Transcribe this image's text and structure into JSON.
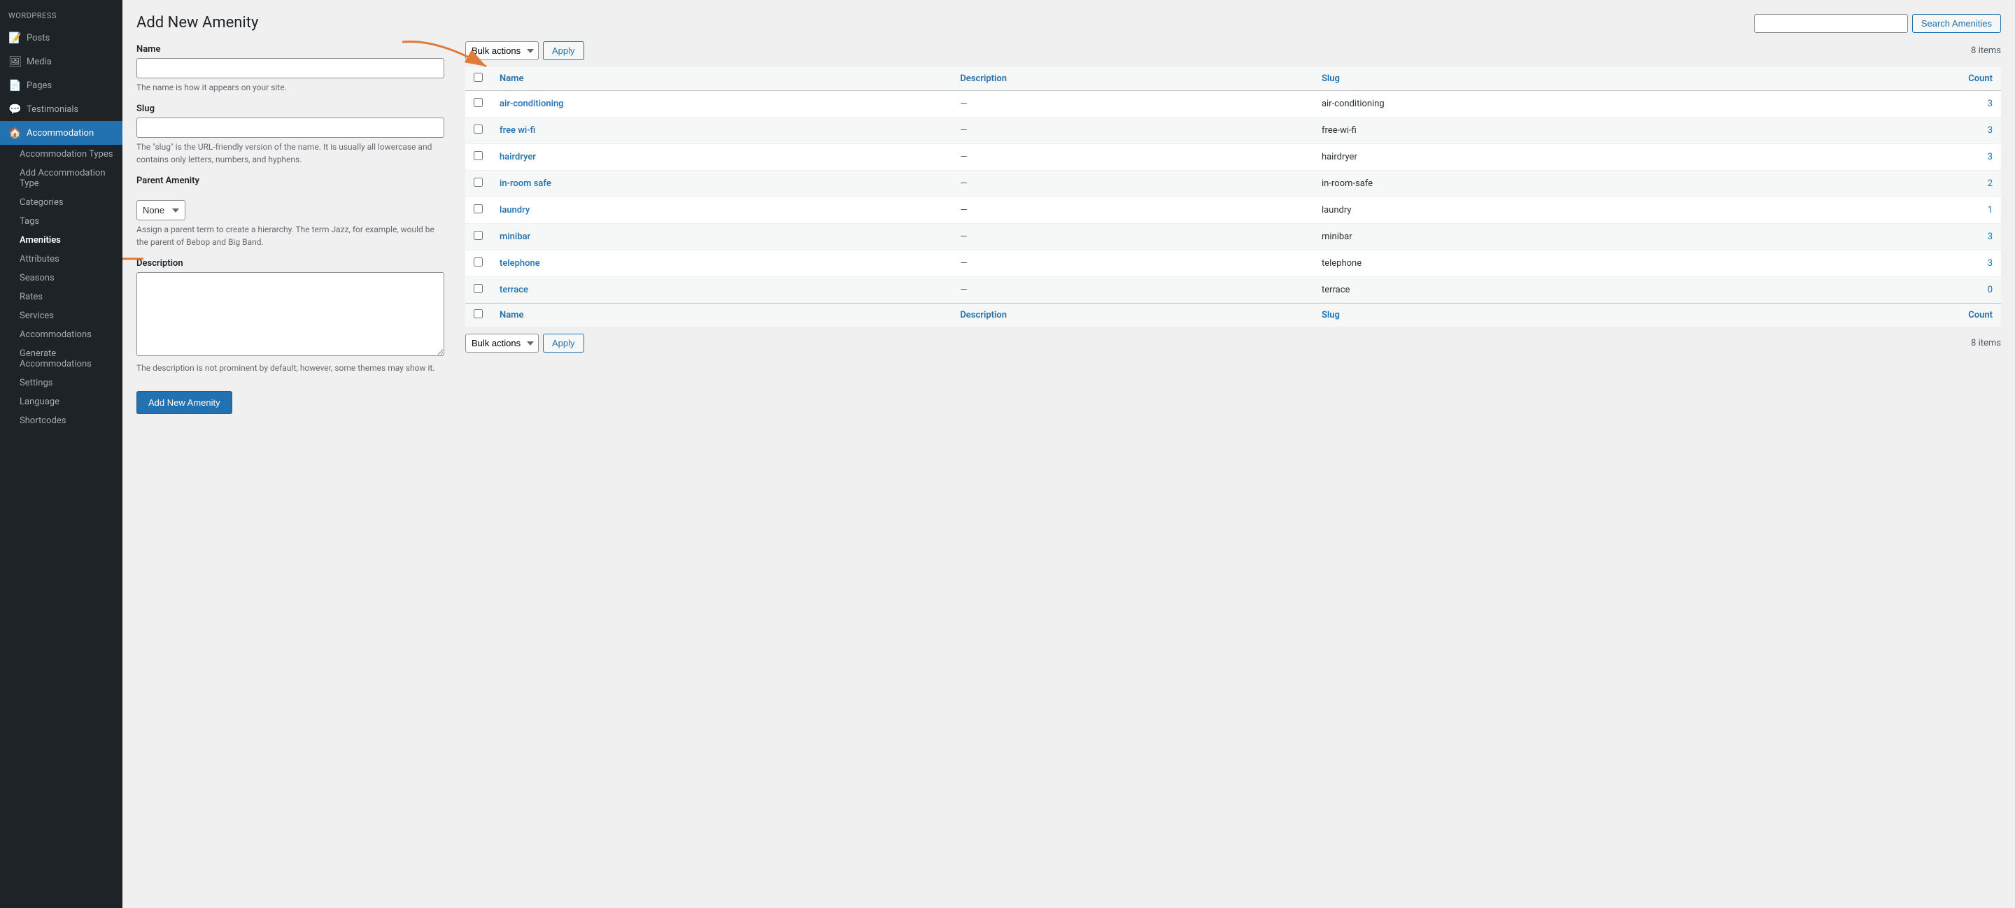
{
  "sidebar": {
    "items": [
      {
        "id": "posts",
        "label": "Posts",
        "icon": "📝"
      },
      {
        "id": "media",
        "label": "Media",
        "icon": "🖼"
      },
      {
        "id": "pages",
        "label": "Pages",
        "icon": "📄"
      },
      {
        "id": "testimonials",
        "label": "Testimonials",
        "icon": "💬"
      },
      {
        "id": "accommodation",
        "label": "Accommodation",
        "icon": "🏠",
        "active": true
      }
    ],
    "submenu": [
      {
        "id": "accommodation-types",
        "label": "Accommodation Types"
      },
      {
        "id": "add-accommodation-type",
        "label": "Add Accommodation Type"
      },
      {
        "id": "categories",
        "label": "Categories"
      },
      {
        "id": "tags",
        "label": "Tags"
      },
      {
        "id": "amenities",
        "label": "Amenities",
        "active": true
      },
      {
        "id": "attributes",
        "label": "Attributes"
      },
      {
        "id": "seasons",
        "label": "Seasons"
      },
      {
        "id": "rates",
        "label": "Rates"
      },
      {
        "id": "services",
        "label": "Services"
      },
      {
        "id": "accommodations",
        "label": "Accommodations"
      },
      {
        "id": "generate-accommodations",
        "label": "Generate Accommodations"
      },
      {
        "id": "settings",
        "label": "Settings"
      },
      {
        "id": "language",
        "label": "Language"
      },
      {
        "id": "shortcodes",
        "label": "Shortcodes"
      }
    ]
  },
  "form": {
    "title": "Add New Amenity",
    "name_label": "Name",
    "name_placeholder": "",
    "name_hint": "The name is how it appears on your site.",
    "slug_label": "Slug",
    "slug_placeholder": "",
    "slug_hint": "The \"slug\" is the URL-friendly version of the name. It is usually all lowercase and contains only letters, numbers, and hyphens.",
    "parent_label": "Parent Amenity",
    "parent_default": "None",
    "parent_hint": "Assign a parent term to create a hierarchy. The term Jazz, for example, would be the parent of Bebop and Big Band.",
    "description_label": "Description",
    "description_hint": "The description is not prominent by default; however, some themes may show it.",
    "submit_label": "Add New Amenity"
  },
  "table": {
    "search_placeholder": "",
    "search_button": "Search Amenities",
    "bulk_label": "Bulk actions",
    "apply_label": "Apply",
    "items_count": "8 items",
    "columns": [
      {
        "id": "name",
        "label": "Name"
      },
      {
        "id": "description",
        "label": "Description"
      },
      {
        "id": "slug",
        "label": "Slug"
      },
      {
        "id": "count",
        "label": "Count"
      }
    ],
    "rows": [
      {
        "id": 1,
        "name": "air-conditioning",
        "description": "—",
        "slug": "air-conditioning",
        "count": "3"
      },
      {
        "id": 2,
        "name": "free wi-fi",
        "description": "—",
        "slug": "free-wi-fi",
        "count": "3"
      },
      {
        "id": 3,
        "name": "hairdryer",
        "description": "—",
        "slug": "hairdryer",
        "count": "3"
      },
      {
        "id": 4,
        "name": "in-room safe",
        "description": "—",
        "slug": "in-room-safe",
        "count": "2"
      },
      {
        "id": 5,
        "name": "laundry",
        "description": "—",
        "slug": "laundry",
        "count": "1"
      },
      {
        "id": 6,
        "name": "minibar",
        "description": "—",
        "slug": "minibar",
        "count": "3"
      },
      {
        "id": 7,
        "name": "telephone",
        "description": "—",
        "slug": "telephone",
        "count": "3"
      },
      {
        "id": 8,
        "name": "terrace",
        "description": "—",
        "slug": "terrace",
        "count": "0"
      }
    ]
  }
}
